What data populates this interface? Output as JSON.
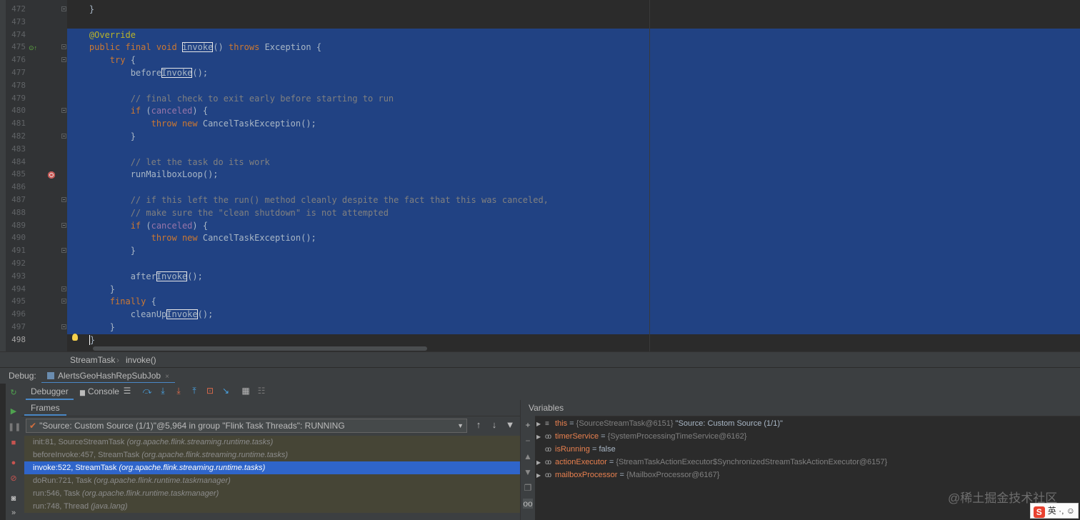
{
  "editor": {
    "lines": [
      {
        "num": "472",
        "code": [
          {
            "t": "    }"
          }
        ],
        "fold": true
      },
      {
        "num": "473",
        "code": []
      },
      {
        "num": "474",
        "code": [
          {
            "t": "    "
          },
          {
            "t": "@Override",
            "c": "ann"
          }
        ],
        "sel": true
      },
      {
        "num": "475",
        "code": [
          {
            "t": "    "
          },
          {
            "t": "public final void ",
            "c": "kw"
          },
          {
            "t": "invoke",
            "c": "hl"
          },
          {
            "t": "() "
          },
          {
            "t": "throws",
            "c": "kw"
          },
          {
            "t": " Exception {"
          }
        ],
        "sel": true,
        "fold": true
      },
      {
        "num": "476",
        "code": [
          {
            "t": "        "
          },
          {
            "t": "try",
            "c": "kw"
          },
          {
            "t": " {"
          }
        ],
        "sel": true,
        "fold": true
      },
      {
        "num": "477",
        "code": [
          {
            "t": "            before"
          },
          {
            "t": "Invoke",
            "c": "hl"
          },
          {
            "t": "();"
          }
        ],
        "sel": true
      },
      {
        "num": "478",
        "code": [],
        "sel": true
      },
      {
        "num": "479",
        "code": [
          {
            "t": "            "
          },
          {
            "t": "// final check to exit early before starting to run",
            "c": "cm"
          }
        ],
        "sel": true
      },
      {
        "num": "480",
        "code": [
          {
            "t": "            "
          },
          {
            "t": "if",
            "c": "kw"
          },
          {
            "t": " ("
          },
          {
            "t": "canceled",
            "c": "fld"
          },
          {
            "t": ") {"
          }
        ],
        "sel": true,
        "fold": true
      },
      {
        "num": "481",
        "code": [
          {
            "t": "                "
          },
          {
            "t": "throw new ",
            "c": "kw"
          },
          {
            "t": "CancelTaskException();"
          }
        ],
        "sel": true
      },
      {
        "num": "482",
        "code": [
          {
            "t": "            }"
          }
        ],
        "sel": true,
        "fold": true
      },
      {
        "num": "483",
        "code": [],
        "sel": true
      },
      {
        "num": "484",
        "code": [
          {
            "t": "            "
          },
          {
            "t": "// let the task do its work",
            "c": "cm"
          }
        ],
        "sel": true
      },
      {
        "num": "485",
        "code": [
          {
            "t": "            runMailboxLoop();"
          }
        ],
        "sel": true
      },
      {
        "num": "486",
        "code": [],
        "sel": true
      },
      {
        "num": "487",
        "code": [
          {
            "t": "            "
          },
          {
            "t": "// if this left the run() method cleanly despite the fact that this was canceled,",
            "c": "cm"
          }
        ],
        "sel": true,
        "fold": true
      },
      {
        "num": "488",
        "code": [
          {
            "t": "            "
          },
          {
            "t": "// make sure the \"clean shutdown\" is not attempted",
            "c": "cm"
          }
        ],
        "sel": true
      },
      {
        "num": "489",
        "code": [
          {
            "t": "            "
          },
          {
            "t": "if",
            "c": "kw"
          },
          {
            "t": " ("
          },
          {
            "t": "canceled",
            "c": "fld"
          },
          {
            "t": ") {"
          }
        ],
        "sel": true,
        "fold": true
      },
      {
        "num": "490",
        "code": [
          {
            "t": "                "
          },
          {
            "t": "throw new ",
            "c": "kw"
          },
          {
            "t": "CancelTaskException();"
          }
        ],
        "sel": true
      },
      {
        "num": "491",
        "code": [
          {
            "t": "            }"
          }
        ],
        "sel": true,
        "fold": true
      },
      {
        "num": "492",
        "code": [],
        "sel": true
      },
      {
        "num": "493",
        "code": [
          {
            "t": "            after"
          },
          {
            "t": "Invoke",
            "c": "hl"
          },
          {
            "t": "();"
          }
        ],
        "sel": true
      },
      {
        "num": "494",
        "code": [
          {
            "t": "        }"
          }
        ],
        "sel": true,
        "fold": true
      },
      {
        "num": "495",
        "code": [
          {
            "t": "        "
          },
          {
            "t": "finally",
            "c": "kw"
          },
          {
            "t": " {"
          }
        ],
        "sel": true,
        "fold": true
      },
      {
        "num": "496",
        "code": [
          {
            "t": "            cleanUp"
          },
          {
            "t": "Invoke",
            "c": "hl"
          },
          {
            "t": "();"
          }
        ],
        "sel": true
      },
      {
        "num": "497",
        "code": [
          {
            "t": "        }"
          }
        ],
        "sel": true,
        "fold": true
      },
      {
        "num": "498",
        "code": [
          {
            "t": "    "
          },
          {
            "t": "}",
            "c": "caret"
          }
        ],
        "sel": true,
        "cur": true
      }
    ]
  },
  "breadcrumb": {
    "class_name": "StreamTask",
    "sep": "›",
    "method": "invoke()"
  },
  "debug": {
    "label": "Debug:",
    "session_tab": "AlertsGeoHashRepSubJob",
    "close": "×",
    "tabs": {
      "debugger": "Debugger",
      "console": "Console"
    }
  },
  "frames": {
    "title": "Frames",
    "thread": "\"Source: Custom Source (1/1)\"@5,964 in group \"Flink Task Threads\": RUNNING",
    "items": [
      {
        "method": "init:81, SourceStreamTask",
        "pkg": "(org.apache.flink.streaming.runtime.tasks)"
      },
      {
        "method": "beforeInvoke:457, StreamTask",
        "pkg": "(org.apache.flink.streaming.runtime.tasks)"
      },
      {
        "method": "invoke:522, StreamTask",
        "pkg": "(org.apache.flink.streaming.runtime.tasks)",
        "selected": true
      },
      {
        "method": "doRun:721, Task",
        "pkg": "(org.apache.flink.runtime.taskmanager)"
      },
      {
        "method": "run:546, Task",
        "pkg": "(org.apache.flink.runtime.taskmanager)"
      },
      {
        "method": "run:748, Thread",
        "pkg": "(java.lang)"
      }
    ]
  },
  "variables": {
    "title": "Variables",
    "items": [
      {
        "name": "this",
        "value": " = ",
        "type": "{SourceStreamTask@6151}",
        "extra": " \"Source: Custom Source (1/1)\"",
        "expand": true,
        "icon": "≡"
      },
      {
        "name": "timerService",
        "value": " = ",
        "type": "{SystemProcessingTimeService@6162}",
        "extra": "",
        "expand": true,
        "icon": "oo"
      },
      {
        "name": "isRunning",
        "value": " = false",
        "type": "",
        "extra": "",
        "expand": false,
        "icon": "oo"
      },
      {
        "name": "actionExecutor",
        "value": " = ",
        "type": "{StreamTaskActionExecutor$SynchronizedStreamTaskActionExecutor@6157}",
        "extra": "",
        "expand": true,
        "icon": "oo"
      },
      {
        "name": "mailboxProcessor",
        "value": " = ",
        "type": "{MailboxProcessor@6167}",
        "extra": "",
        "expand": true,
        "icon": "oo"
      }
    ]
  },
  "watermark": "@稀土掘金技术社区",
  "ime": {
    "s": "S",
    "text": "英 ·, ☺"
  }
}
